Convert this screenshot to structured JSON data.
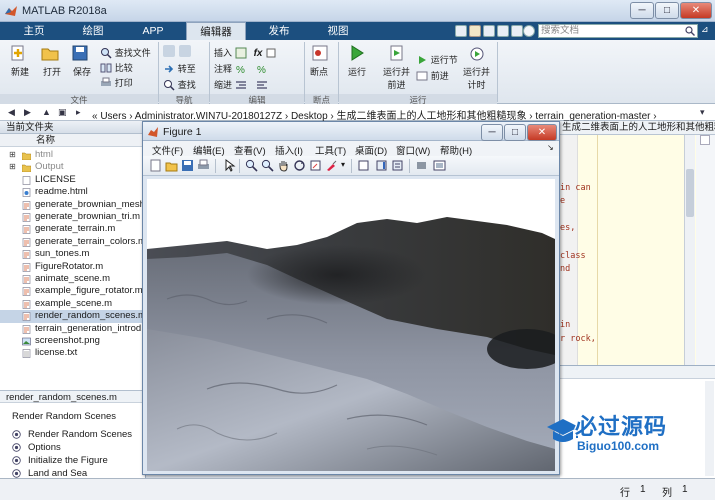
{
  "app": {
    "title": "MATLAB R2018a"
  },
  "tabs": [
    {
      "label": "主页"
    },
    {
      "label": "绘图"
    },
    {
      "label": "APP"
    },
    {
      "label": "编辑器"
    },
    {
      "label": "发布"
    },
    {
      "label": "视图"
    }
  ],
  "search": {
    "placeholder": "搜索文档"
  },
  "ribbon": {
    "file": {
      "new": "新建",
      "open": "打开",
      "save": "保存",
      "find_files": "查找文件",
      "compare": "比较",
      "print": "打印",
      "group": "文件"
    },
    "nav": {
      "goto": "转至",
      "find": "查找",
      "group": "导航"
    },
    "edit": {
      "insert": "插入",
      "comment": "注释",
      "indent": "缩进",
      "fx": "fx",
      "group": "编辑"
    },
    "breakpoints": {
      "label": "断点",
      "group": "断点"
    },
    "run": {
      "run": "运行",
      "run_advance_1": "运行并",
      "run_advance_2": "前进",
      "run_section": "运行节",
      "advance": "前进",
      "run_time_1": "运行并",
      "run_time_2": "计时",
      "group": "运行"
    }
  },
  "address": {
    "crumbs": "«  Users  ›  Administrator.WIN7U-20180127Z  ›  Desktop  ›  生成二维表面上的人工地形和其他粗糙现象  ›  terrain_generation-master  ›"
  },
  "left_panel": {
    "title": "当前文件夹",
    "column": "名称",
    "files": [
      {
        "name": "html",
        "type": "folder",
        "muted": true
      },
      {
        "name": "Output",
        "type": "folder",
        "muted": true
      },
      {
        "name": "LICENSE",
        "type": "file"
      },
      {
        "name": "readme.html",
        "type": "html"
      },
      {
        "name": "generate_brownian_mesh",
        "type": "m"
      },
      {
        "name": "generate_brownian_tri.m",
        "type": "m"
      },
      {
        "name": "generate_terrain.m",
        "type": "m"
      },
      {
        "name": "generate_terrain_colors.m",
        "type": "m"
      },
      {
        "name": "sun_tones.m",
        "type": "m"
      },
      {
        "name": "FigureRotator.m",
        "type": "m"
      },
      {
        "name": "animate_scene.m",
        "type": "m"
      },
      {
        "name": "example_figure_rotator.m",
        "type": "m"
      },
      {
        "name": "example_scene.m",
        "type": "m"
      },
      {
        "name": "render_random_scenes.m",
        "type": "m",
        "selected": true
      },
      {
        "name": "terrain_generation_introd",
        "type": "m"
      },
      {
        "name": "screenshot.png",
        "type": "img"
      },
      {
        "name": "license.txt",
        "type": "txt"
      }
    ],
    "detail_title": "render_random_scenes.m",
    "detail_heading": "Render Random Scenes",
    "detail_items": [
      "Render Random Scenes",
      "Options",
      "Initialize the Figure",
      "Land and Sea"
    ]
  },
  "editor": {
    "tab_label": "生成二维表面上的人工地形和其他粗糙现象\\terrain_gener...",
    "code_fragments": [
      "in can",
      "e",
      "es,",
      "class",
      "nd",
      "in",
      "r rock,"
    ]
  },
  "figure": {
    "title": "Figure 1",
    "menu": [
      "文件(F)",
      "编辑(E)",
      "查看(V)",
      "插入(I)",
      "工具(T)",
      "桌面(D)",
      "窗口(W)",
      "帮助(H)"
    ]
  },
  "status": {
    "row_label": "行",
    "row": "1",
    "col_label": "列",
    "col": "1"
  },
  "watermark": {
    "title": "必过源码",
    "url": "Biguo100.com"
  },
  "colors": {
    "ribbon_tab_bg": "#1c4f7f",
    "accent": "#2c6fb3"
  }
}
